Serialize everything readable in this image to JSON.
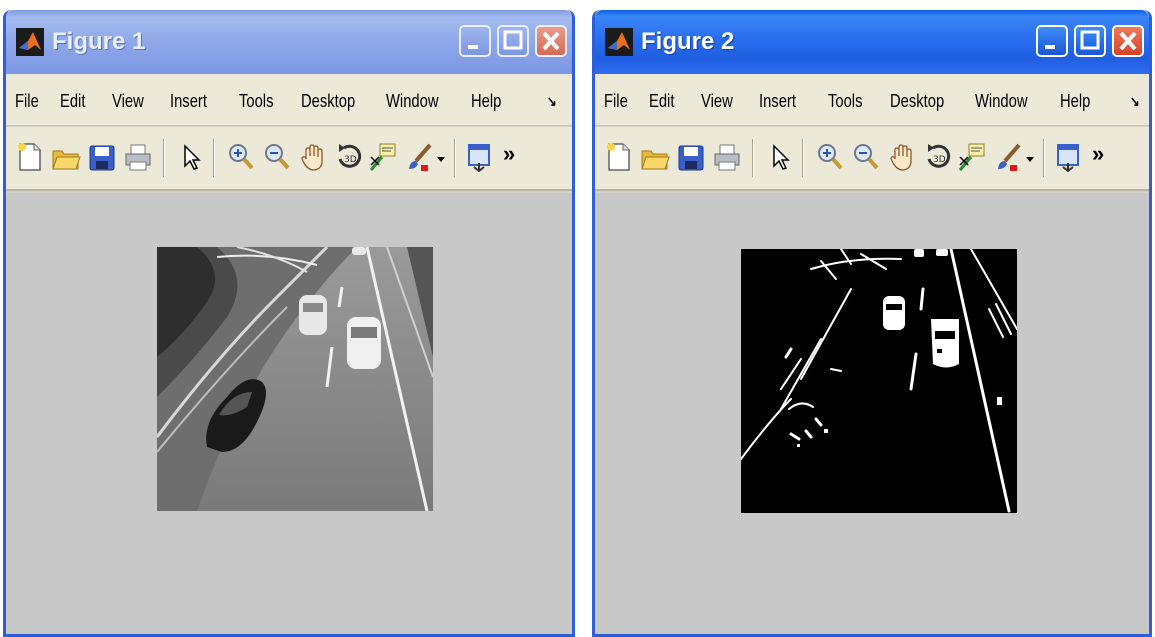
{
  "figure1": {
    "title": "Figure 1",
    "menu": [
      "File",
      "Edit",
      "View",
      "Insert",
      "Tools",
      "Desktop",
      "Window",
      "Help"
    ],
    "image": "grayscale-highway-traffic-image"
  },
  "figure2": {
    "title": "Figure 2",
    "menu": [
      "File",
      "Edit",
      "View",
      "Insert",
      "Tools",
      "Desktop",
      "Window",
      "Help"
    ],
    "image": "binary-edge-highway-traffic-image"
  },
  "toolbar_icons": [
    "new-file-icon",
    "open-folder-icon",
    "save-icon",
    "print-icon",
    "pointer-icon",
    "zoom-in-icon",
    "zoom-out-icon",
    "pan-hand-icon",
    "rotate-3d-icon",
    "data-cursor-icon",
    "brush-icon",
    "dropdown-arrow-icon",
    "dock-figure-icon",
    "more-chevron-icon"
  ],
  "more_glyph": "»",
  "menu_overflow_glyph": "↘"
}
